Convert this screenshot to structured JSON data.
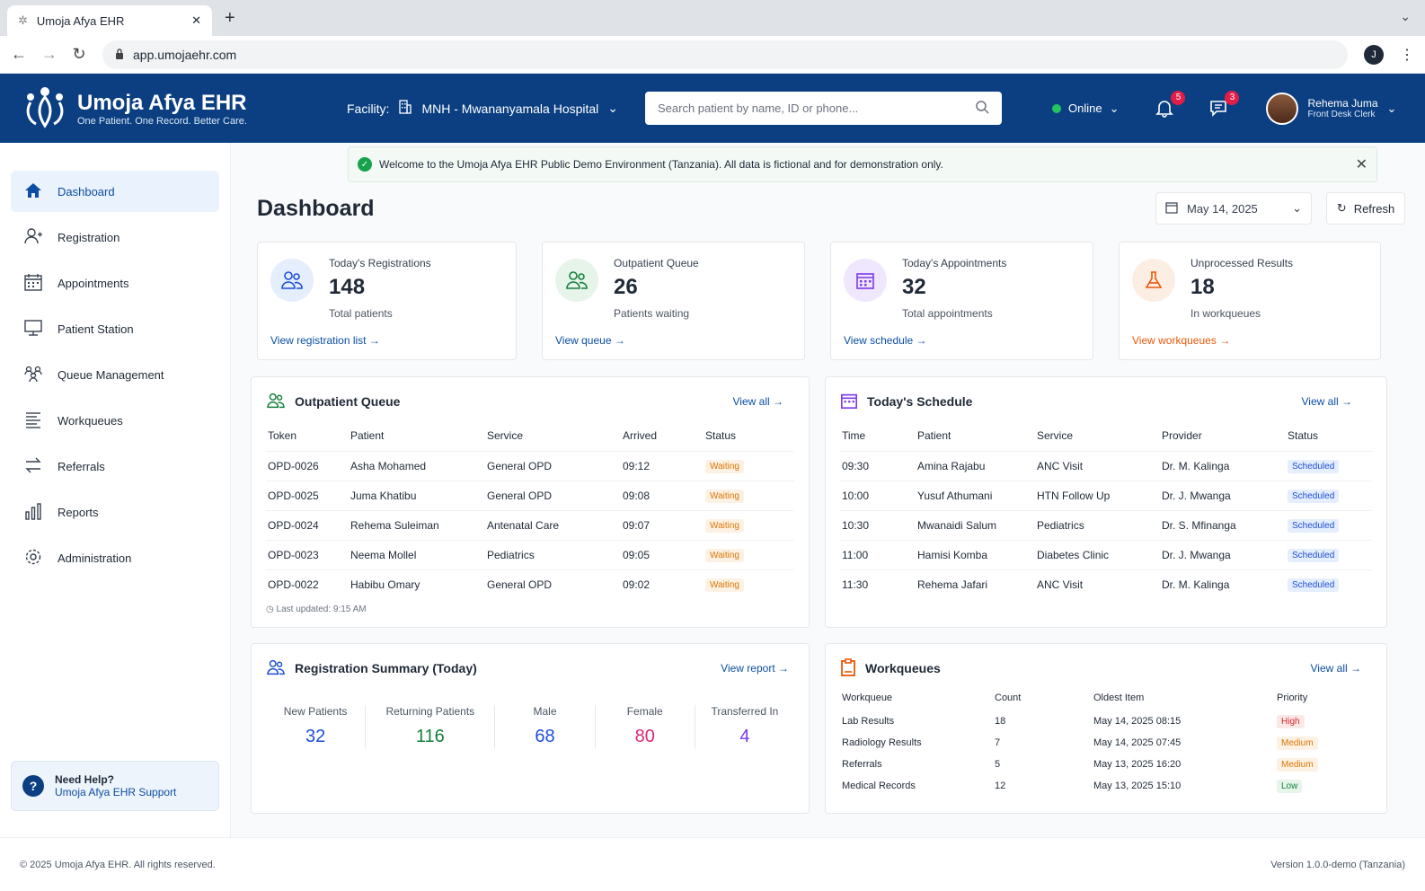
{
  "browser": {
    "tab_title": "Umoja Afya EHR",
    "url": "app.umojaehr.com",
    "account_initial": "J"
  },
  "header": {
    "app_name": "Umoja Afya EHR",
    "tagline": "One Patient. One Record. Better Care.",
    "facility_label": "Facility:",
    "facility_value": "MNH - Mwananyamala Hospital",
    "search_placeholder": "Search patient by name, ID or phone...",
    "status": "Online",
    "notifications_count": "5",
    "messages_count": "3",
    "user_name": "Rehema Juma",
    "user_role": "Front Desk Clerk",
    "colors": {
      "header_bg": "#0b3f82",
      "online": "#22c55e",
      "badge": "#e11d48"
    }
  },
  "sidebar": {
    "items": [
      {
        "label": "Dashboard",
        "icon": "home-icon",
        "active": true
      },
      {
        "label": "Registration",
        "icon": "user-plus-icon"
      },
      {
        "label": "Appointments",
        "icon": "calendar-icon"
      },
      {
        "label": "Patient Station",
        "icon": "monitor-icon"
      },
      {
        "label": "Queue Management",
        "icon": "users-queue-icon"
      },
      {
        "label": "Workqueues",
        "icon": "list-icon"
      },
      {
        "label": "Referrals",
        "icon": "arrows-exchange-icon"
      },
      {
        "label": "Reports",
        "icon": "bar-chart-icon"
      },
      {
        "label": "Administration",
        "icon": "gear-icon"
      }
    ],
    "help_title": "Need Help?",
    "help_link": "Umoja Afya EHR Support"
  },
  "banner": {
    "text": "Welcome to the Umoja Afya EHR Public Demo Environment (Tanzania). All data is fictional and for demonstration only."
  },
  "page": {
    "title": "Dashboard",
    "date": "May 14, 2025",
    "refresh": "Refresh"
  },
  "stats": [
    {
      "label": "Today's Registrations",
      "value": "148",
      "sub": "Total patients",
      "link": "View registration list",
      "color": "#1d4ed8"
    },
    {
      "label": "Outpatient Queue",
      "value": "26",
      "sub": "Patients waiting",
      "link": "View queue",
      "color": "#15803d"
    },
    {
      "label": "Today's Appointments",
      "value": "32",
      "sub": "Total appointments",
      "link": "View schedule",
      "color": "#7c3aed"
    },
    {
      "label": "Unprocessed Results",
      "value": "18",
      "sub": "In workqueues",
      "link": "View workqueues",
      "color": "#ea580c"
    }
  ],
  "queue": {
    "title": "Outpatient Queue",
    "view_all": "View all",
    "columns": [
      "Token",
      "Patient",
      "Service",
      "Arrived",
      "Status"
    ],
    "rows": [
      [
        "OPD-0026",
        "Asha Mohamed",
        "General OPD",
        "09:12",
        "Waiting"
      ],
      [
        "OPD-0025",
        "Juma Khatibu",
        "General OPD",
        "09:08",
        "Waiting"
      ],
      [
        "OPD-0024",
        "Rehema Suleiman",
        "Antenatal Care",
        "09:07",
        "Waiting"
      ],
      [
        "OPD-0023",
        "Neema Mollel",
        "Pediatrics",
        "09:05",
        "Waiting"
      ],
      [
        "OPD-0022",
        "Habibu Omary",
        "General OPD",
        "09:02",
        "Waiting"
      ]
    ],
    "updated": "Last updated: 9:15 AM"
  },
  "schedule": {
    "title": "Today's Schedule",
    "view_all": "View all",
    "columns": [
      "Time",
      "Patient",
      "Service",
      "Provider",
      "Status"
    ],
    "rows": [
      [
        "09:30",
        "Amina Rajabu",
        "ANC Visit",
        "Dr. M. Kalinga",
        "Scheduled"
      ],
      [
        "10:00",
        "Yusuf Athumani",
        "HTN Follow Up",
        "Dr. J. Mwanga",
        "Scheduled"
      ],
      [
        "10:30",
        "Mwanaidi Salum",
        "Pediatrics",
        "Dr. S. Mfinanga",
        "Scheduled"
      ],
      [
        "11:00",
        "Hamisi Komba",
        "Diabetes Clinic",
        "Dr. J. Mwanga",
        "Scheduled"
      ],
      [
        "11:30",
        "Rehema Jafari",
        "ANC Visit",
        "Dr. M. Kalinga",
        "Scheduled"
      ]
    ]
  },
  "registration_summary": {
    "title": "Registration Summary (Today)",
    "view": "View report",
    "items": [
      {
        "label": "New Patients",
        "value": "32",
        "color": "#1d4ed8"
      },
      {
        "label": "Returning Patients",
        "value": "116",
        "color": "#15803d"
      },
      {
        "label": "Male",
        "value": "68",
        "color": "#1d4ed8"
      },
      {
        "label": "Female",
        "value": "80",
        "color": "#db2777"
      },
      {
        "label": "Transferred In",
        "value": "4",
        "color": "#7c3aed"
      }
    ]
  },
  "workqueues": {
    "title": "Workqueues",
    "view_all": "View all",
    "columns": [
      "Workqueue",
      "Count",
      "Oldest Item",
      "Priority"
    ],
    "rows": [
      [
        "Lab Results",
        "18",
        "May 14, 2025 08:15",
        "High"
      ],
      [
        "Radiology Results",
        "7",
        "May 14, 2025 07:45",
        "Medium"
      ],
      [
        "Referrals",
        "5",
        "May 13, 2025 16:20",
        "Medium"
      ],
      [
        "Medical Records",
        "12",
        "May 13, 2025 15:10",
        "Low"
      ]
    ]
  },
  "footer": {
    "copyright": "© 2025 Umoja Afya EHR. All rights reserved.",
    "version": "Version 1.0.0-demo (Tanzania)"
  }
}
